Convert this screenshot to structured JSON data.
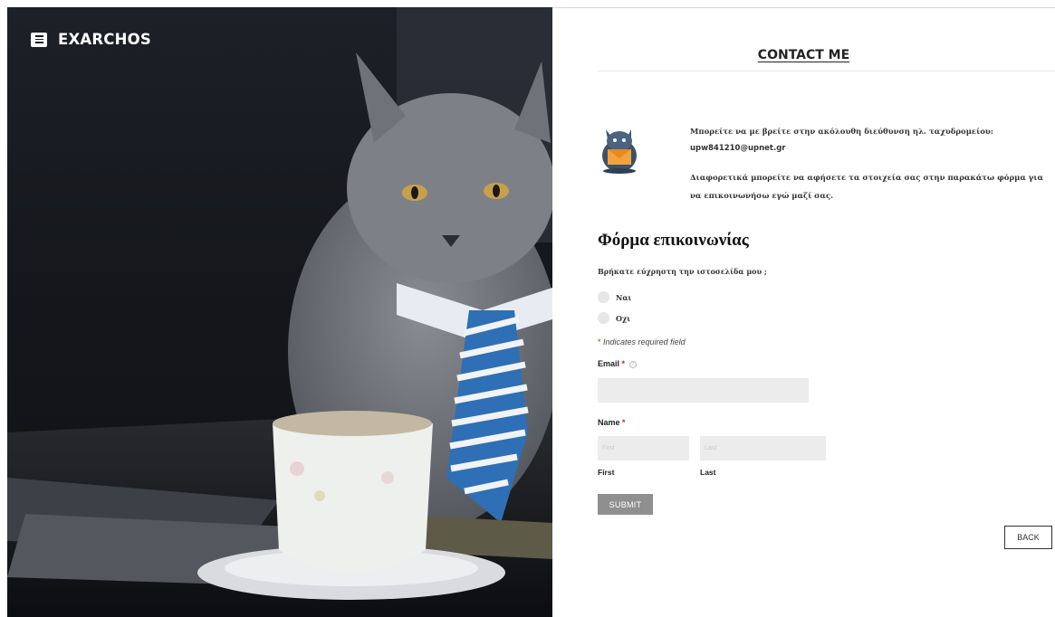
{
  "brand": {
    "name": "EXARCHOS",
    "menu_icon": "hamburger-menu-icon"
  },
  "hero": {
    "description_icon": "cat-in-tie-photo"
  },
  "page": {
    "title": "CONTACT ME"
  },
  "intro": {
    "line1": "Μπορείτε να με βρείτε στην ακόλουθη διεύθυνση ηλ. ταχυδρομείου:",
    "email": "upw841210@upnet.gr",
    "line2": "Διαφορετικά μπορείτε να αφήσετε τα στοιχεία σας στην παρακάτω φόρμα για να επικοινωνήσω εγώ μαζί σας."
  },
  "form": {
    "heading": "Φόρμα επικοινωνίας",
    "question": "Βρήκατε εύχρηστη την ιστοσελίδα μου ;",
    "options": [
      "Ναι",
      "Οχι"
    ],
    "required_star": "*",
    "required_note": "Indicates required field",
    "email_label": "Email",
    "email_value": "",
    "name_label": "Name",
    "first_placeholder": "First",
    "last_placeholder": "Last",
    "first_sublabel": "First",
    "last_sublabel": "Last",
    "submit_label": "SUBMIT"
  },
  "nav": {
    "back_label": "BACK"
  },
  "colors": {
    "required": "#c02b0a",
    "submit_bg": "#8f8f8f",
    "input_bg": "#ececec"
  }
}
